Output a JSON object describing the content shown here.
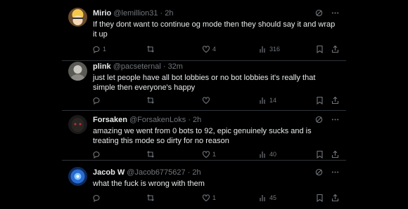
{
  "colors": {
    "background": "#000000",
    "text": "#e7e9ea",
    "muted": "#71767b",
    "divider": "#2f3336"
  },
  "icons": {
    "grok": "grok-icon",
    "more": "more-dots-icon",
    "reply": "reply-icon",
    "repost": "repost-icon",
    "like": "like-icon",
    "views": "views-icon",
    "bookmark": "bookmark-icon",
    "share": "share-icon"
  },
  "replies": [
    {
      "name": "Mirio",
      "handle": "@lemillion31",
      "time": "· 2h",
      "text": "If they dont want to continue og mode then they should say it and wrap it up",
      "replies": "1",
      "reposts": "",
      "likes": "4",
      "views": "316"
    },
    {
      "name": "plink",
      "handle": "@pacseternal",
      "time": "· 32m",
      "text": "just let people have all bot lobbies or no bot lobbies it's really that simple then everyone's happy",
      "replies": "",
      "reposts": "",
      "likes": "",
      "views": "14"
    },
    {
      "name": "Forsaken",
      "handle": "@ForsakenLoks",
      "time": "· 2h",
      "text": "amazing we went from 0 bots to 92, epic genuinely sucks and is treating this mode so dirty for no reason",
      "replies": "",
      "reposts": "",
      "likes": "1",
      "views": "40"
    },
    {
      "name": "Jacob W",
      "handle": "@Jacob6775627",
      "time": "· 2h",
      "text": "what the fuck is wrong with them",
      "replies": "",
      "reposts": "",
      "likes": "1",
      "views": "45"
    }
  ]
}
